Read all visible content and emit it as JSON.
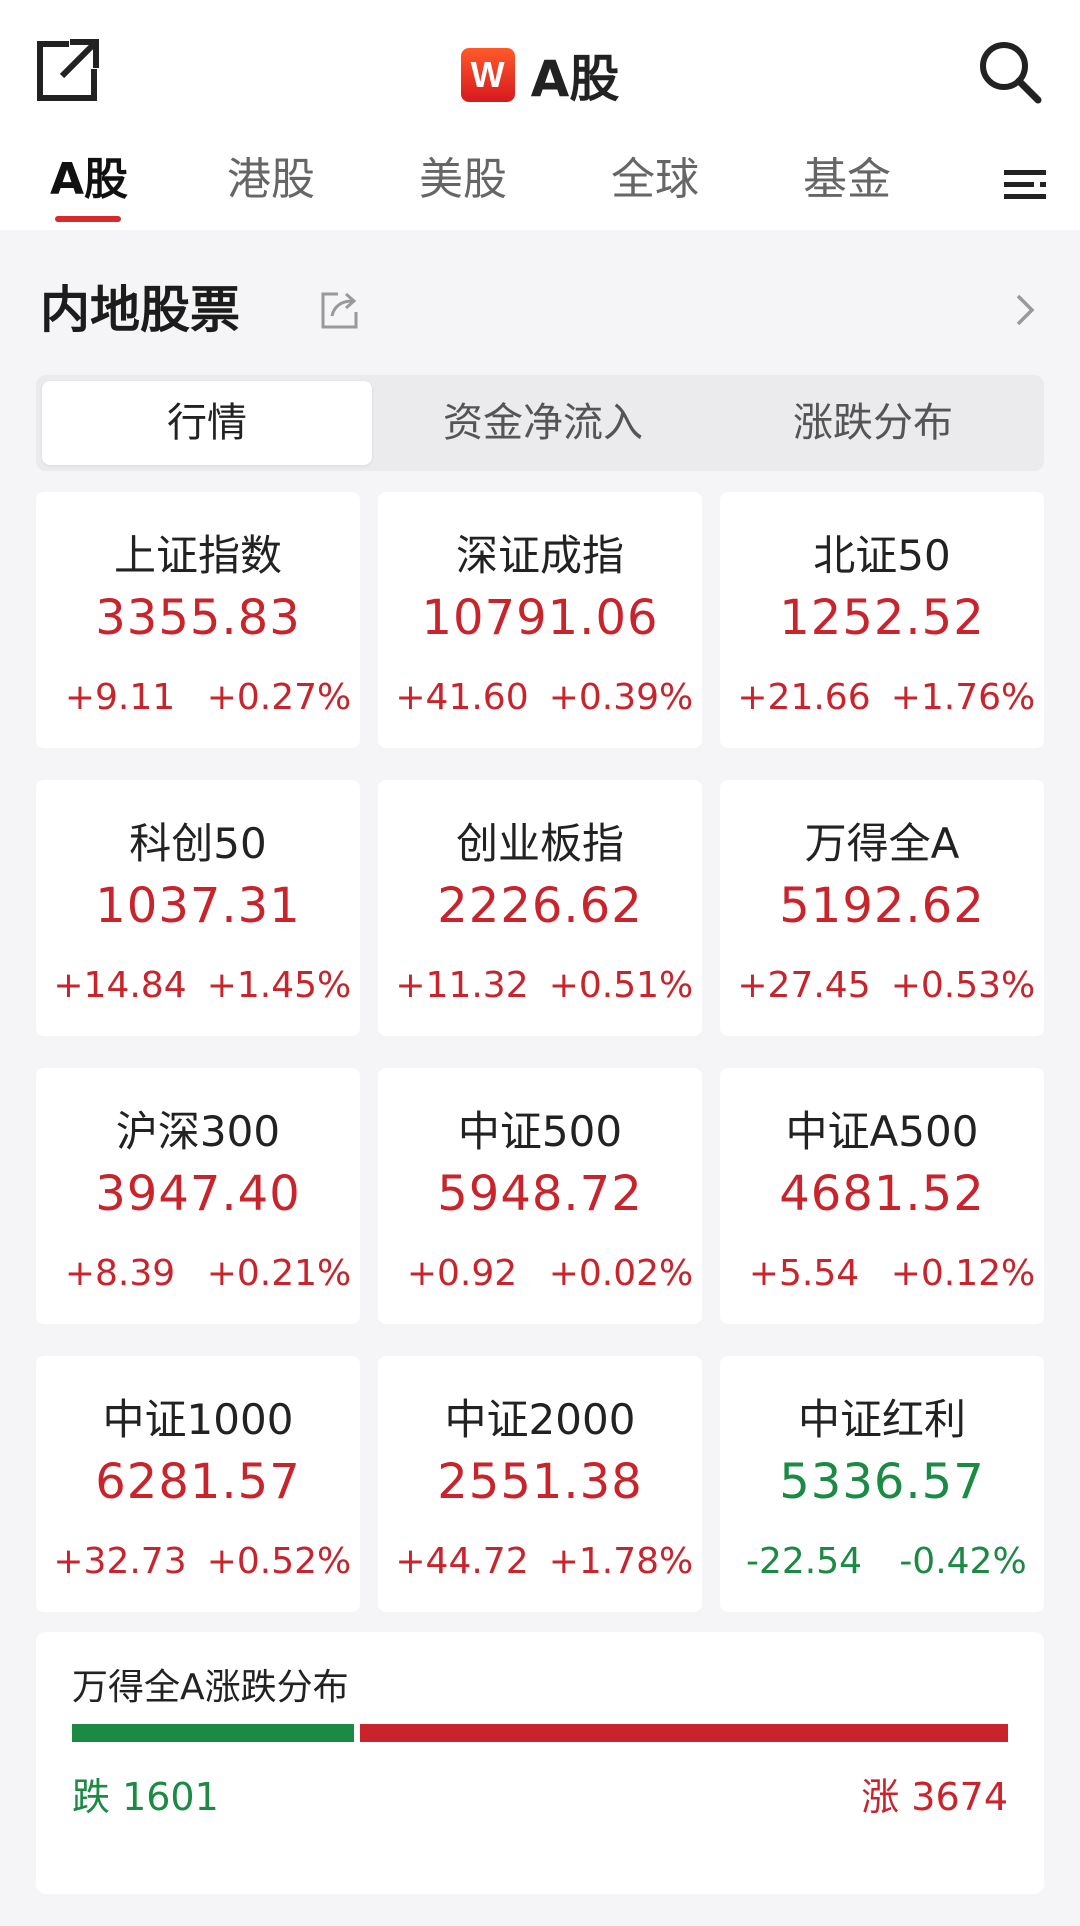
{
  "header": {
    "title": "A股",
    "logo_text": "W"
  },
  "market_tabs": [
    "A股",
    "港股",
    "美股",
    "全球",
    "基金"
  ],
  "section": {
    "title": "内地股票"
  },
  "segments": [
    "行情",
    "资金净流入",
    "涨跌分布"
  ],
  "indices": [
    {
      "name": "上证指数",
      "price": "3355.83",
      "change": "+9.11",
      "pct": "+0.27%",
      "dir": "up"
    },
    {
      "name": "深证成指",
      "price": "10791.06",
      "change": "+41.60",
      "pct": "+0.39%",
      "dir": "up"
    },
    {
      "name": "北证50",
      "price": "1252.52",
      "change": "+21.66",
      "pct": "+1.76%",
      "dir": "up"
    },
    {
      "name": "科创50",
      "price": "1037.31",
      "change": "+14.84",
      "pct": "+1.45%",
      "dir": "up"
    },
    {
      "name": "创业板指",
      "price": "2226.62",
      "change": "+11.32",
      "pct": "+0.51%",
      "dir": "up"
    },
    {
      "name": "万得全A",
      "price": "5192.62",
      "change": "+27.45",
      "pct": "+0.53%",
      "dir": "up"
    },
    {
      "name": "沪深300",
      "price": "3947.40",
      "change": "+8.39",
      "pct": "+0.21%",
      "dir": "up"
    },
    {
      "name": "中证500",
      "price": "5948.72",
      "change": "+0.92",
      "pct": "+0.02%",
      "dir": "up"
    },
    {
      "name": "中证A500",
      "price": "4681.52",
      "change": "+5.54",
      "pct": "+0.12%",
      "dir": "up"
    },
    {
      "name": "中证1000",
      "price": "6281.57",
      "change": "+32.73",
      "pct": "+0.52%",
      "dir": "up"
    },
    {
      "name": "中证2000",
      "price": "2551.38",
      "change": "+44.72",
      "pct": "+1.78%",
      "dir": "up"
    },
    {
      "name": "中证红利",
      "price": "5336.57",
      "change": "-22.54",
      "pct": "-0.42%",
      "dir": "down"
    }
  ],
  "breadth": {
    "title": "万得全A涨跌分布",
    "fall_label": "跌 1601",
    "rise_label": "涨 3674",
    "fall": 1601,
    "rise": 3674,
    "colors": {
      "rise": "#c9232b",
      "fall": "#1b8a43"
    }
  },
  "icons": [
    "share-out-icon",
    "search-icon",
    "menu-icon",
    "share-icon",
    "chevron-right-icon"
  ]
}
